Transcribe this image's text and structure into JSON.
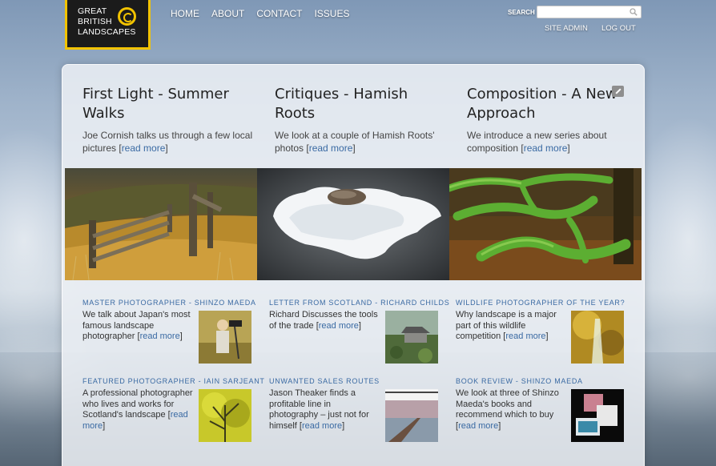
{
  "logo": {
    "line1": "GREAT",
    "line2": "BRITISH",
    "line3": "LANDSCAPES"
  },
  "nav": {
    "home": "HOME",
    "about": "ABOUT",
    "contact": "CONTACT",
    "issues": "ISSUES"
  },
  "search": {
    "label": "SEARCH",
    "placeholder": ""
  },
  "util": {
    "site_admin": "SITE ADMIN",
    "log_out": "LOG OUT"
  },
  "features": [
    {
      "title": "First Light - Summer Walks",
      "text": "Joe Cornish talks us through a few local pictures [",
      "link": "read more",
      "close": "]"
    },
    {
      "title": "Critiques - Hamish Roots",
      "text": "We look at a couple of Hamish Roots' photos [",
      "link": "read more",
      "close": "]"
    },
    {
      "title": "Composition - A New Approach",
      "text": "We introduce a new series about composition [",
      "link": "read more",
      "close": "]"
    }
  ],
  "items": [
    {
      "heading": "MASTER PHOTOGRAPHER - SHINZO MAEDA",
      "text": "We talk about Japan's most famous landscape photographer [",
      "link": "read more",
      "close": "]"
    },
    {
      "heading": "LETTER FROM SCOTLAND - RICHARD CHILDS",
      "text": "Richard Discusses the tools of the trade [",
      "link": "read more",
      "close": "]"
    },
    {
      "heading": "WILDLIFE PHOTOGRAPHER OF THE YEAR?",
      "text": "Why landscape is a major part of this wildlife competition [",
      "link": "read more",
      "close": "]"
    },
    {
      "heading": "FEATURED PHOTOGRAPHER - IAIN SARJEANT",
      "text": "A professional photographer who lives and works for Scotland's landscape [",
      "link": "read more",
      "close": "]"
    },
    {
      "heading": "UNWANTED SALES ROUTES",
      "text": "Jason Theaker finds a profitable line in photography – just not for himself [",
      "link": "read more",
      "close": "]"
    },
    {
      "heading": "BOOK REVIEW - SHINZO MAEDA",
      "text": "We look at three of Shinzo Maeda's books and recommend which to buy [",
      "link": "read more",
      "close": "]"
    }
  ],
  "colors": {
    "logo_accent": "#f2c300",
    "link": "#3a6aa3"
  }
}
